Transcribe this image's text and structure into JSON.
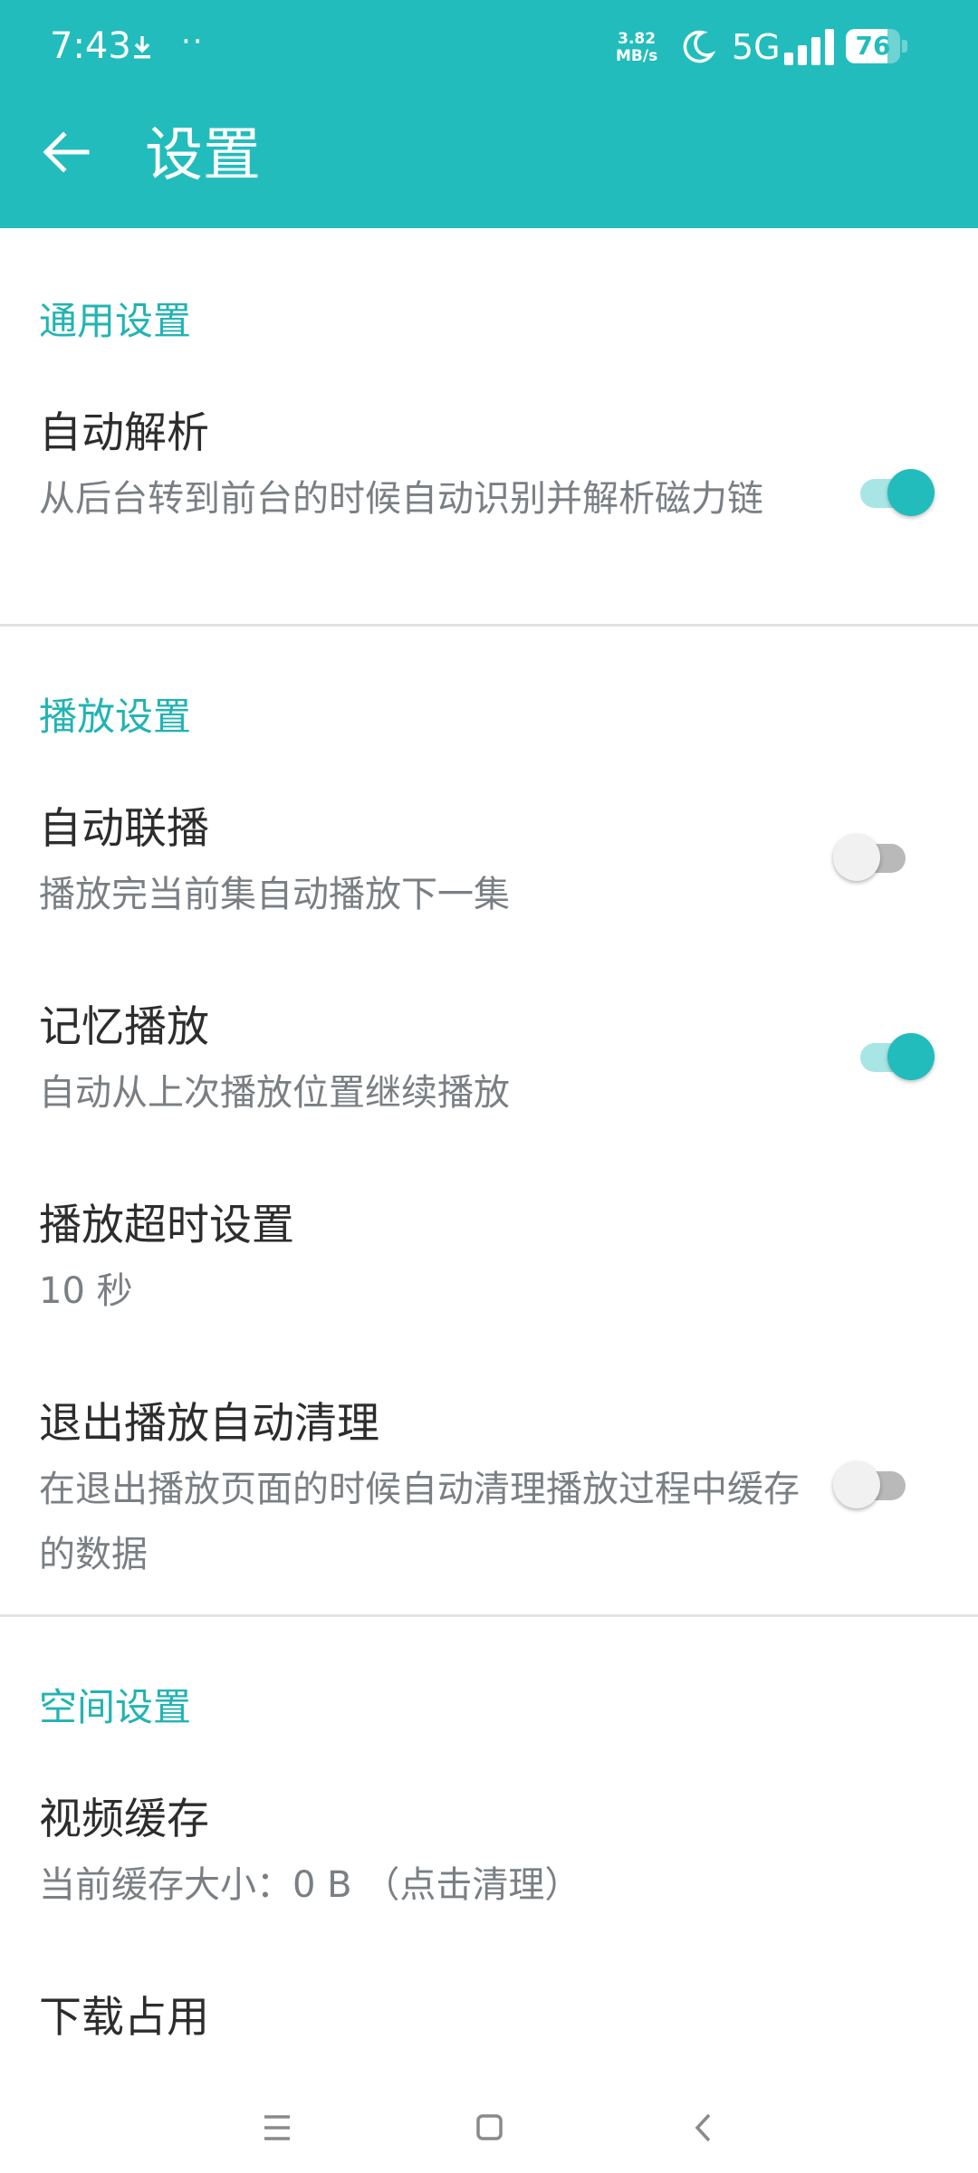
{
  "status_bar": {
    "time": "7:43",
    "speed_value": "3.82",
    "speed_unit": "MB/s",
    "network": "5G",
    "battery": "76",
    "battery_level": 0.76
  },
  "header": {
    "title": "设置",
    "accent_color": "#23bcbc"
  },
  "sections": {
    "general": {
      "title": "通用设置",
      "auto_parse": {
        "title": "自动解析",
        "subtitle": "从后台转到前台的时候自动识别并解析磁力链",
        "enabled": true
      }
    },
    "playback": {
      "title": "播放设置",
      "auto_next": {
        "title": "自动联播",
        "subtitle": "播放完当前集自动播放下一集",
        "enabled": false
      },
      "resume": {
        "title": "记忆播放",
        "subtitle": "自动从上次播放位置继续播放",
        "enabled": true
      },
      "timeout": {
        "title": "播放超时设置",
        "value": "10 秒"
      },
      "auto_clean": {
        "title": "退出播放自动清理",
        "subtitle": "在退出播放页面的时候自动清理播放过程中缓存的数据",
        "enabled": false
      }
    },
    "storage": {
      "title": "空间设置",
      "video_cache": {
        "title": "视频缓存",
        "subtitle": "当前缓存大小：0 B （点击清理）"
      },
      "download_usage": {
        "title": "下载占用"
      }
    }
  },
  "icons": {
    "back": "arrow-left-icon",
    "nav_menu": "menu-icon",
    "nav_home": "home-icon",
    "nav_back": "chevron-left-icon"
  }
}
